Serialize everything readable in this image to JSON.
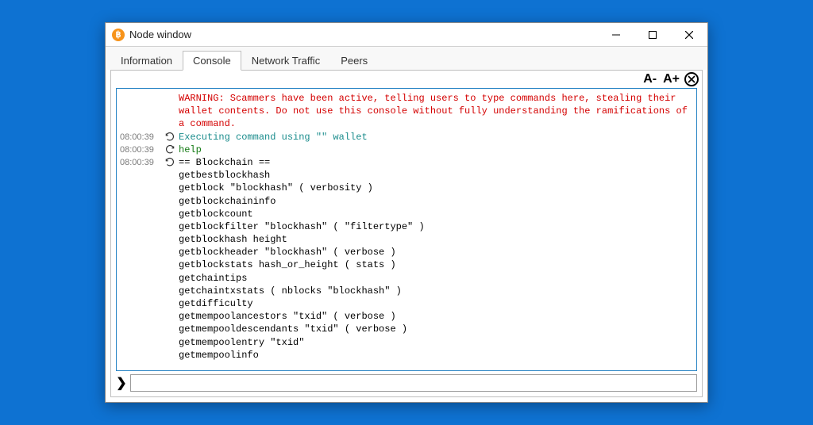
{
  "window": {
    "title": "Node window",
    "icon_letter": "฿"
  },
  "tabs": [
    {
      "label": "Information",
      "active": false
    },
    {
      "label": "Console",
      "active": true
    },
    {
      "label": "Network Traffic",
      "active": false
    },
    {
      "label": "Peers",
      "active": false
    }
  ],
  "toolbar": {
    "zoom_out": "A-",
    "zoom_in": "A+",
    "clear": "⊘"
  },
  "console": {
    "warning": "WARNING: Scammers have been active, telling users to type commands here, stealing their wallet contents. Do not use this console without fully understanding the ramifications of a command.",
    "entries": [
      {
        "time": "08:00:39",
        "dir": "in",
        "style": "teal",
        "text": "Executing command using \"\" wallet"
      },
      {
        "time": "08:00:39",
        "dir": "out",
        "style": "info",
        "text": "help"
      },
      {
        "time": "08:00:39",
        "dir": "in",
        "style": "",
        "text": "== Blockchain ==\ngetbestblockhash\ngetblock \"blockhash\" ( verbosity )\ngetblockchaininfo\ngetblockcount\ngetblockfilter \"blockhash\" ( \"filtertype\" )\ngetblockhash height\ngetblockheader \"blockhash\" ( verbose )\ngetblockstats hash_or_height ( stats )\ngetchaintips\ngetchaintxstats ( nblocks \"blockhash\" )\ngetdifficulty\ngetmempoolancestors \"txid\" ( verbose )\ngetmempooldescendants \"txid\" ( verbose )\ngetmempoolentry \"txid\"\ngetmempoolinfo"
      }
    ]
  },
  "input": {
    "prompt": "❯",
    "value": "",
    "placeholder": ""
  }
}
